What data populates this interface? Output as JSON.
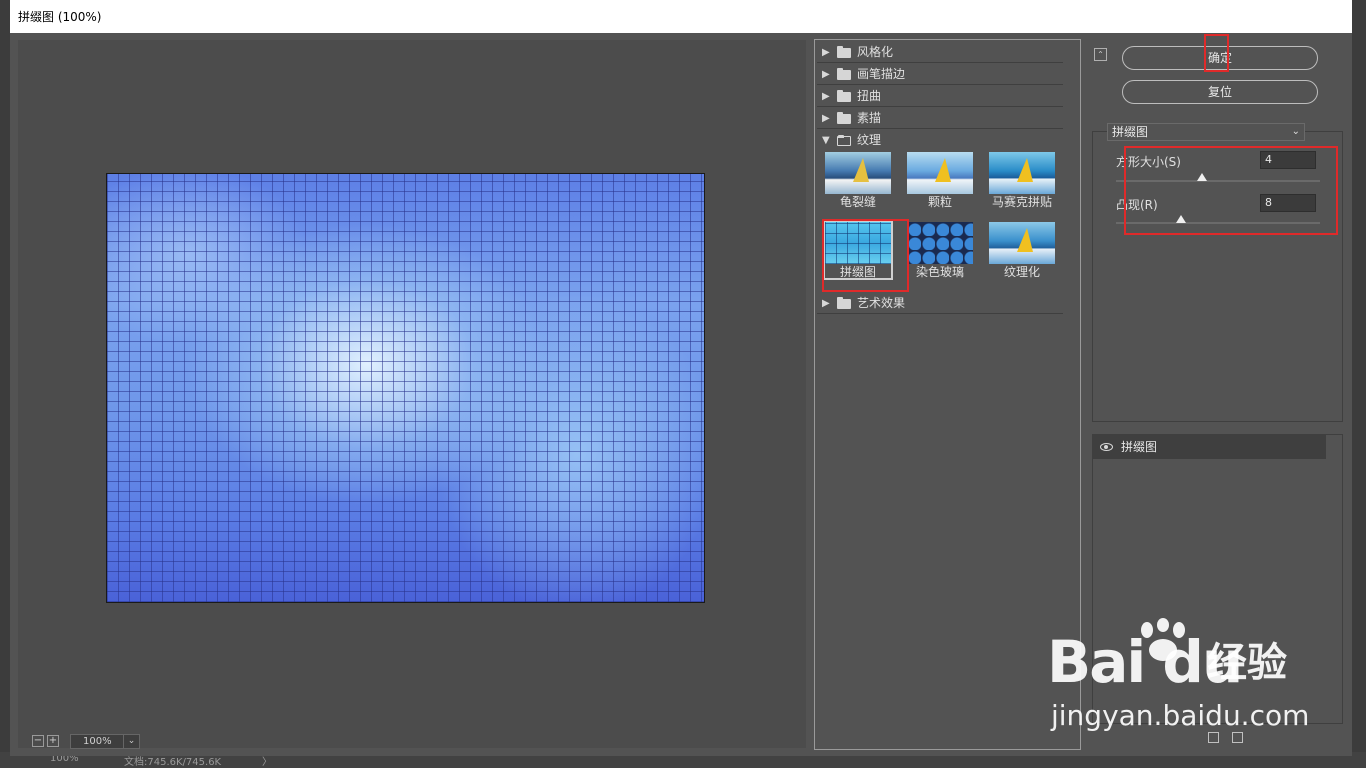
{
  "dialog": {
    "title": "拼缀图 (100%)"
  },
  "preview": {
    "zoom_out": "−",
    "zoom_in": "+",
    "zoom_value": "100%",
    "zoom_dropdown": "⌄"
  },
  "status_bar": {
    "zoom": "100%",
    "doc_info": "文档:745.6K/745.6K",
    "arrow": "〉"
  },
  "filter_gallery": {
    "categories": [
      {
        "label": "风格化",
        "expanded": false
      },
      {
        "label": "画笔描边",
        "expanded": false
      },
      {
        "label": "扭曲",
        "expanded": false
      },
      {
        "label": "素描",
        "expanded": false
      },
      {
        "label": "纹理",
        "expanded": true
      },
      {
        "label": "艺术效果",
        "expanded": false
      }
    ],
    "texture_filters": [
      {
        "label": "龟裂缝"
      },
      {
        "label": "颗粒"
      },
      {
        "label": "马赛克拼贴"
      },
      {
        "label": "拼缀图",
        "selected": true
      },
      {
        "label": "染色玻璃"
      },
      {
        "label": "纹理化"
      }
    ]
  },
  "settings": {
    "ok_label": "确定",
    "reset_label": "复位",
    "collapse_icon": "⌃",
    "selected_filter": "拼缀图",
    "select_dropdown": "⌄",
    "params": [
      {
        "label": "方形大小(S)",
        "value": "4",
        "slider_fraction": 0.42
      },
      {
        "label": "凸现(R)",
        "value": "8",
        "slider_fraction": 0.32
      }
    ],
    "applied_layers": [
      {
        "label": "拼缀图",
        "visible": true
      }
    ]
  },
  "watermark": {
    "logo": "Bai du",
    "cn": "经验",
    "url": "jingyan.baidu.com"
  },
  "colors": {
    "dialog_bg": "#535353",
    "highlight_red": "#e02a2a",
    "titlebar_bg": "#ffffff"
  }
}
